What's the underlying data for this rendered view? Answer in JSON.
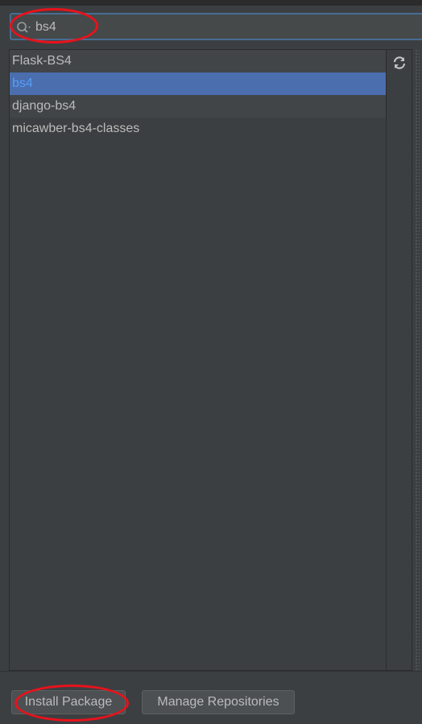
{
  "search": {
    "value": "bs4",
    "icon": "search-icon"
  },
  "packages": {
    "items": [
      {
        "label": "Flask-BS4",
        "selected": false
      },
      {
        "label": "bs4",
        "selected": true
      },
      {
        "label": "django-bs4",
        "selected": false
      },
      {
        "label": "micawber-bs4-classes",
        "selected": false
      }
    ]
  },
  "toolbar": {
    "refresh_icon": "refresh-icon"
  },
  "buttons": {
    "install_label": "Install Package",
    "manage_label": "Manage Repositories"
  },
  "colors": {
    "background": "#3c3f41",
    "selection": "#4b6eaf",
    "selected_text": "#589df6",
    "annotation": "#e8121c"
  }
}
